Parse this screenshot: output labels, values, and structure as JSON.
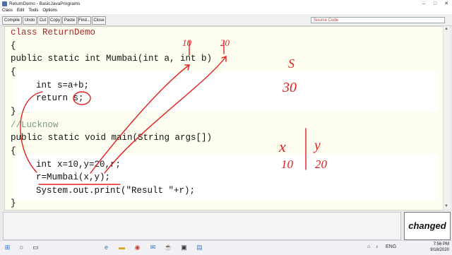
{
  "window": {
    "title": "ReturnDemo - BasicJavaPrograms",
    "min": "–",
    "max": "□",
    "close": "✕"
  },
  "menu": [
    "Class",
    "Edit",
    "Tools",
    "Options"
  ],
  "toolbar": {
    "buttons": [
      "Compile",
      "Undo",
      "Cut",
      "Copy",
      "Paste",
      "Find...",
      "Close"
    ],
    "view_select": "Source Code"
  },
  "code": {
    "line1": "class ReturnDemo",
    "line2": "{",
    "line3": "public static int Mumbai(int a, int b)",
    "line4": "{",
    "line5": "int s=a+b;",
    "line6": "return s;",
    "line7": "}",
    "line8": "//Lucknow",
    "line9": "public static void main(String args[])",
    "line10": "{",
    "line11": "int x=10,y=20,r;",
    "line12": "r=Mumbai(x,y);",
    "line13": "System.out.print(\"Result \"+r);",
    "line14": "}"
  },
  "annotations": {
    "a_val": "10",
    "b_val": "20",
    "s_label": "S",
    "s_val": "30",
    "x_label": "x",
    "y_label": "y",
    "x_val": "10",
    "y_val": "20"
  },
  "status": {
    "changed": "changed"
  },
  "taskbar": {
    "icons": [
      "windows-icon",
      "search-icon",
      "task-view-icon",
      "edge-icon",
      "file-explorer-icon",
      "chrome-icon",
      "mail-icon",
      "java-icon",
      "terminal-icon",
      "notepad-icon"
    ],
    "time": "7:56 PM",
    "date": "9/18/2020",
    "lang": "ENG"
  },
  "colors": {
    "editor_bg": "#fefef0",
    "keyword": "#a52a2a",
    "ink": "#e02020",
    "comment": "#7a9a7a"
  }
}
